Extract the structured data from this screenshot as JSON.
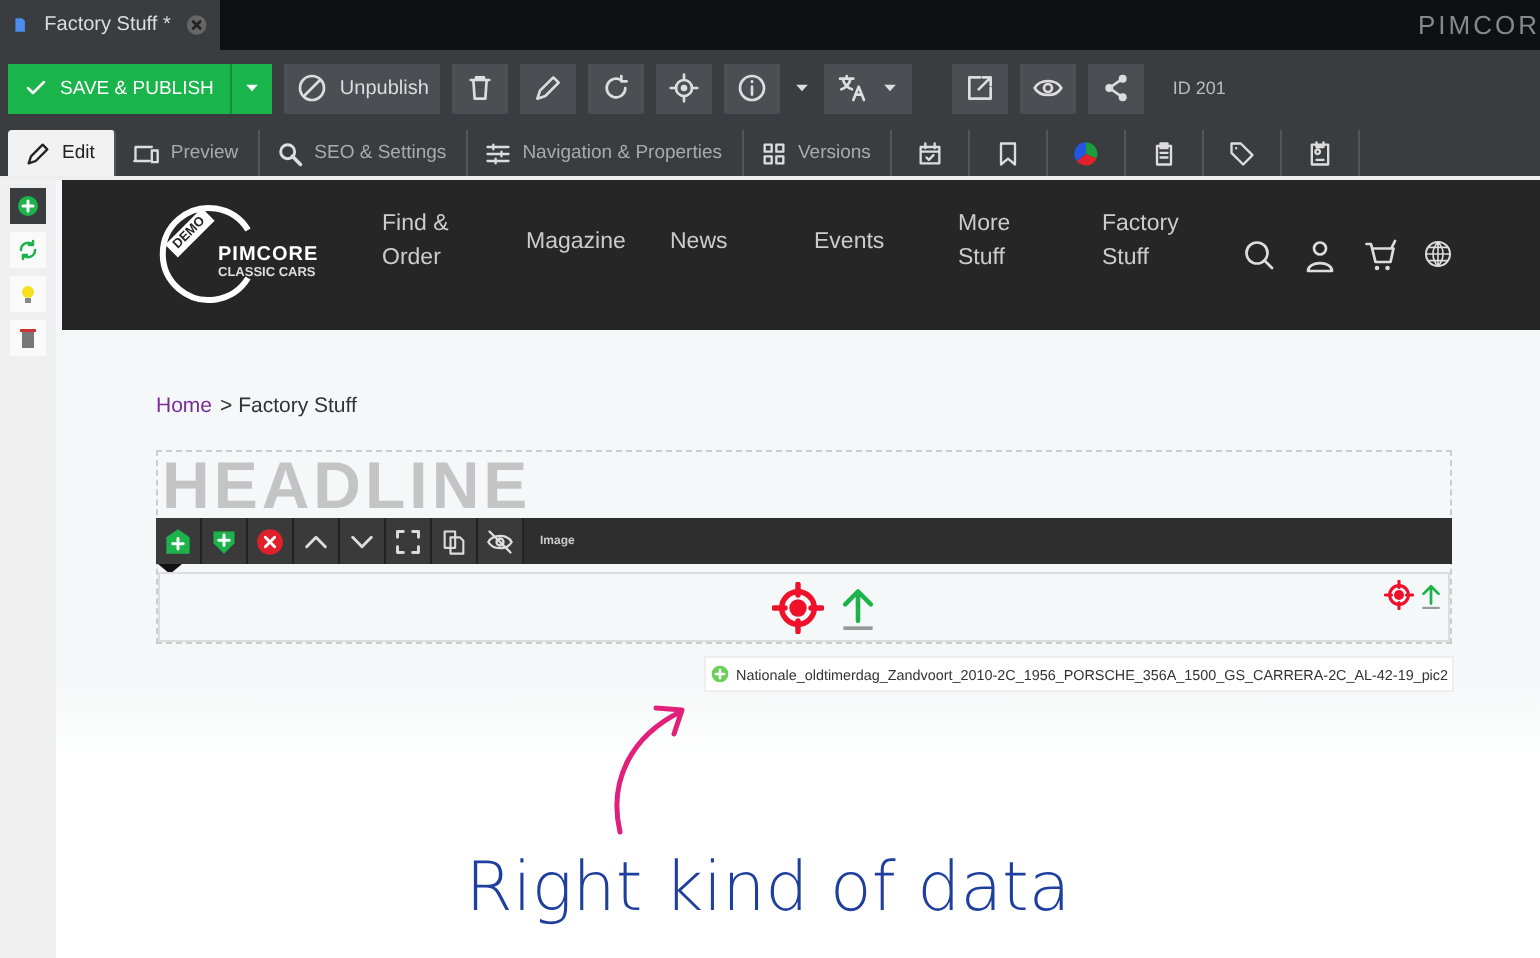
{
  "document_tab": {
    "title": "Factory Stuff *"
  },
  "brand": "PIMCOR",
  "toolbar": {
    "primary": "SAVE & PUBLISH",
    "unpublish": "Unpublish",
    "id_label": "ID 201"
  },
  "editor_tabs": [
    {
      "label": "Edit",
      "selected": true
    },
    {
      "label": "Preview",
      "selected": false
    },
    {
      "label": "SEO & Settings",
      "selected": false
    },
    {
      "label": "Navigation & Properties",
      "selected": false
    },
    {
      "label": "Versions",
      "selected": false
    }
  ],
  "icon_tabs": [
    {
      "selected": false
    },
    {
      "selected": false
    },
    {
      "selected": false
    },
    {
      "selected": false
    },
    {
      "selected": false
    },
    {
      "selected": false
    }
  ],
  "site": {
    "logo_badge": "DEMO",
    "logo_name": "PIMCORE",
    "logo_sub": "CLASSIC CARS",
    "nav": [
      "Find & Order",
      "Magazine",
      "News",
      "Events",
      "More Stuff",
      "Factory Stuff"
    ]
  },
  "breadcrumb": {
    "home": "Home",
    "rest": "> Factory Stuff"
  },
  "headline": "HEADLINE",
  "block_toolbar": {
    "label": "Image"
  },
  "filename": "Nationale_oldtimerdag_Zandvoort_2010-2C_1956_PORSCHE_356A_1500_GS_CARRERA-2C_AL-42-19_pic2",
  "caption": "Right kind of data"
}
